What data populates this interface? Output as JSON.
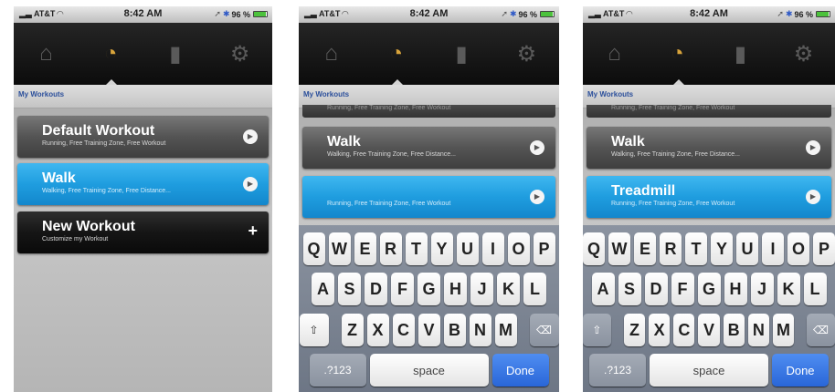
{
  "status": {
    "carrier": "AT&T",
    "time": "8:42 AM",
    "battery": "96 %"
  },
  "nav": {
    "icons": [
      "home-icon",
      "stopwatch-icon",
      "bar-chart-icon",
      "gear-icon"
    ],
    "active": "stopwatch-icon"
  },
  "subbar_label": "My Workouts",
  "screen1": {
    "rows": [
      {
        "title": "Default Workout",
        "subtitle": "Running, Free Training Zone, Free Workout"
      },
      {
        "title": "Walk",
        "subtitle": "Walking, Free Training Zone, Free Distance..."
      },
      {
        "title": "New Workout",
        "subtitle": "Customize my Workout"
      }
    ]
  },
  "screen2": {
    "clipped_subtitle": "Running, Free Training Zone, Free Workout",
    "rows": [
      {
        "title": "Walk",
        "subtitle": "Walking, Free Training Zone, Free Distance..."
      },
      {
        "title": "",
        "subtitle": "Running, Free Training Zone, Free Workout"
      }
    ]
  },
  "screen3": {
    "clipped_subtitle": "Running, Free Training Zone, Free Workout",
    "rows": [
      {
        "title": "Walk",
        "subtitle": "Walking, Free Training Zone, Free Distance..."
      },
      {
        "title": "Treadmill",
        "subtitle": "Running, Free Training Zone, Free Workout"
      }
    ]
  },
  "keyboard": {
    "row1": [
      "Q",
      "W",
      "E",
      "R",
      "T",
      "Y",
      "U",
      "I",
      "O",
      "P"
    ],
    "row2": [
      "A",
      "S",
      "D",
      "F",
      "G",
      "H",
      "J",
      "K",
      "L"
    ],
    "row3": [
      "Z",
      "X",
      "C",
      "V",
      "B",
      "N",
      "M"
    ],
    "numbers_label": ".?123",
    "space_label": "space",
    "done_label": "Done"
  }
}
